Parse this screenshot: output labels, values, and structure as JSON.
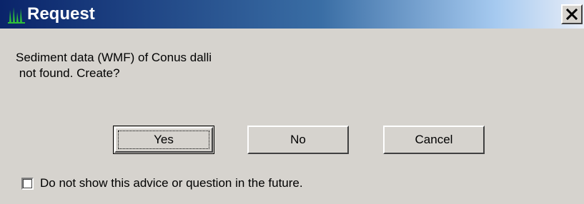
{
  "window": {
    "title": "Request",
    "app_icon": "grass-icon",
    "close_icon": "close-icon",
    "close_glyph": "X"
  },
  "message": {
    "line1": "Sediment data (WMF) of Conus dalli",
    "line2": " not found. Create?"
  },
  "buttons": {
    "yes_label": "Yes",
    "no_label": "No",
    "cancel_label": "Cancel",
    "default_button": "yes"
  },
  "checkbox": {
    "label": "Do not show this advice or question in the future.",
    "checked": false
  },
  "colors": {
    "titlebar_start": "#0a246a",
    "titlebar_end": "#e8edf7",
    "dialog_face": "#d6d3ce",
    "icon_green": "#2fbf3a"
  }
}
